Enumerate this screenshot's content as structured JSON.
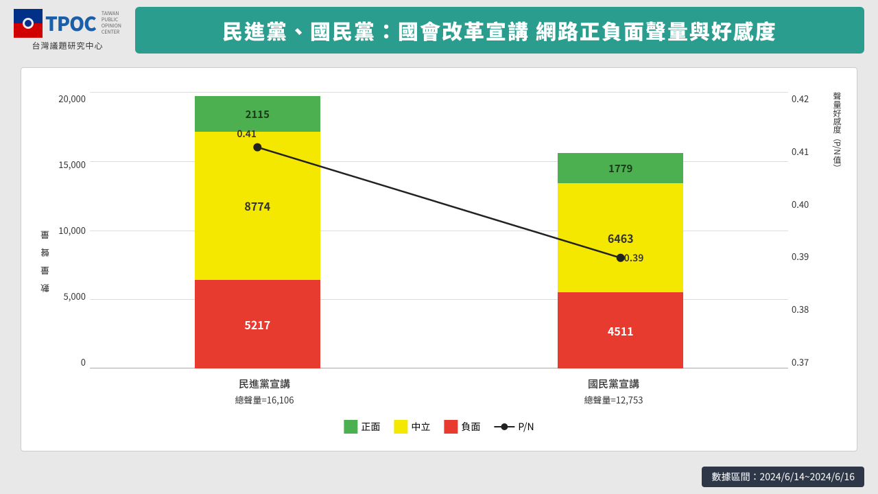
{
  "header": {
    "logo_text": "TPOC",
    "logo_subtitle": "台灣議題研究中心",
    "title": "民進黨、國民黨：國會改革宣講  網路正負面聲量與好感度"
  },
  "chart": {
    "y_axis_left_title": "數 量 聲 量",
    "y_axis_right_title": "聲量好感度（P/N值）",
    "y_left_labels": [
      "20,000",
      "15,000",
      "10,000",
      "5,000",
      "0"
    ],
    "y_right_labels": [
      "0.42",
      "0.41",
      "0.40",
      "0.39",
      "0.38",
      "0.37"
    ],
    "bars": [
      {
        "name": "民進黨宣講",
        "total_label": "總聲量=16,106",
        "negative": 5217,
        "neutral": 8774,
        "positive": 2115,
        "pn_value": 0.41,
        "pn_label": "0.41"
      },
      {
        "name": "國民黨宣講",
        "total_label": "總聲量=12,753",
        "negative": 4511,
        "neutral": 6463,
        "positive": 1779,
        "pn_value": 0.39,
        "pn_label": "0.39"
      }
    ],
    "legend": {
      "positive_label": "正面",
      "neutral_label": "中立",
      "negative_label": "負面",
      "line_label": "P/N"
    }
  },
  "footer": {
    "date_range": "數據區間：2024/6/14~2024/6/16"
  }
}
